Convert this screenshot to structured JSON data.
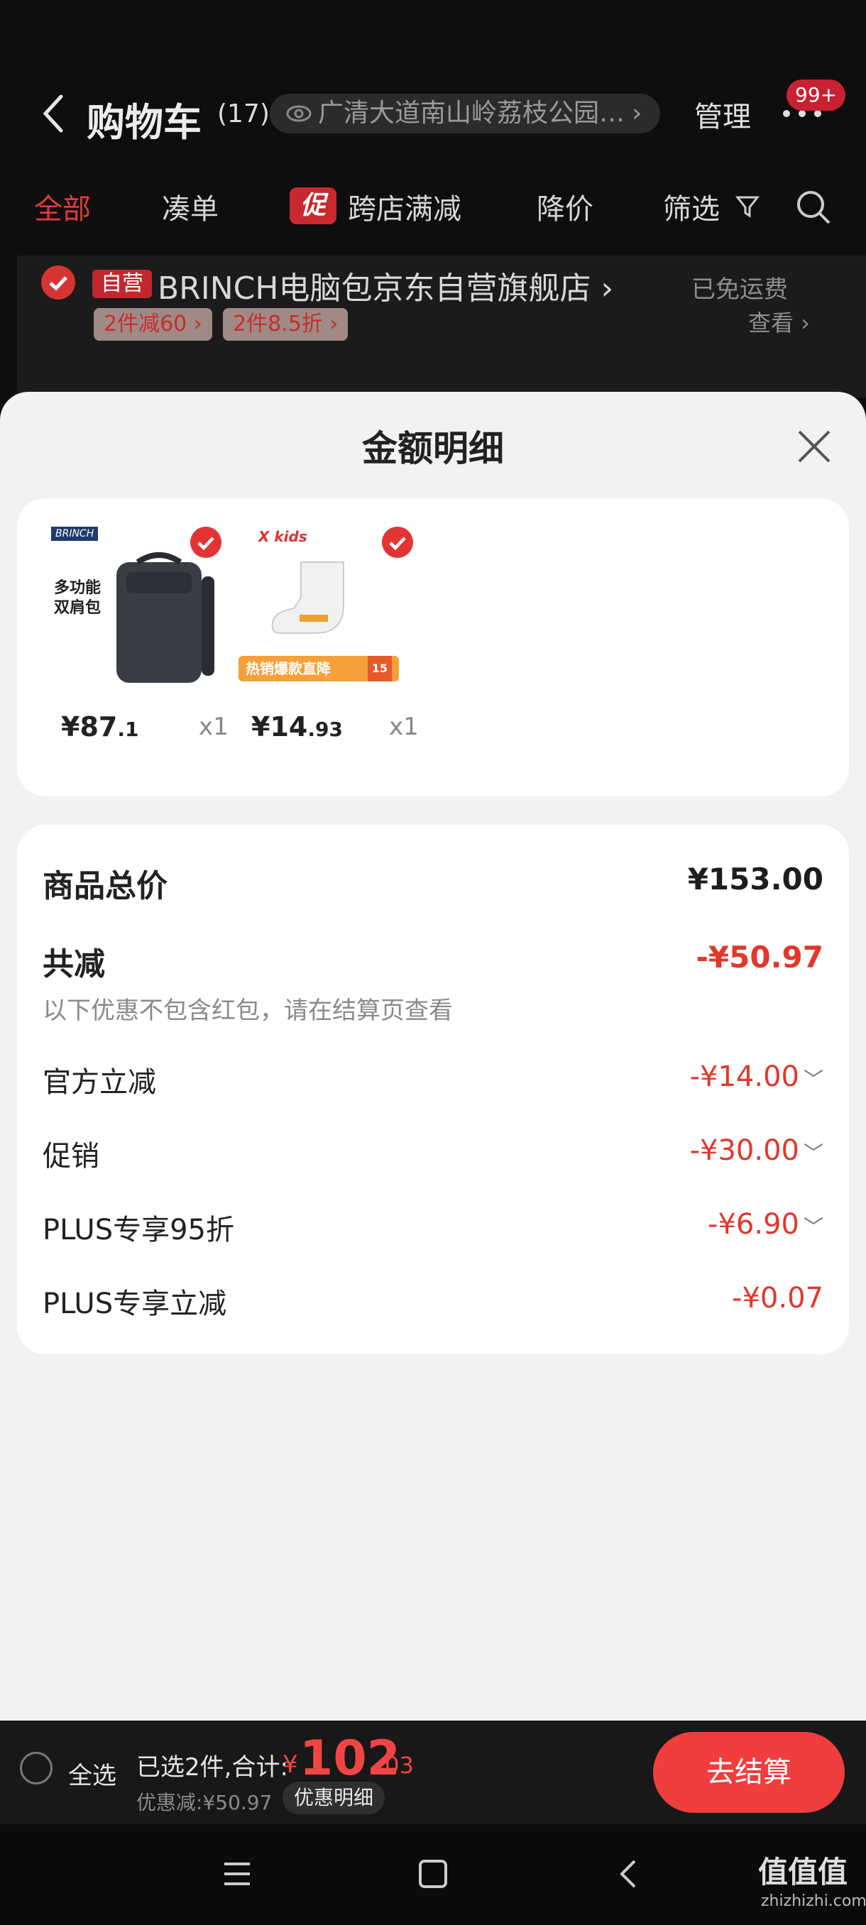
{
  "header": {
    "title": "购物车",
    "count": "(17)",
    "address": "广清大道南山岭荔枝公园…",
    "manage": "管理",
    "badge": "99+"
  },
  "tabs": [
    "全部",
    "凑单",
    "跨店满减",
    "降价",
    "筛选"
  ],
  "promo_icon_text": "促",
  "shop": {
    "self_badge": "自营",
    "name": "BRINCH电脑包京东自营旗舰店 ›",
    "freeship": "已免运费",
    "view": "查看 ›",
    "coupons": [
      "2件减60 ›",
      "2件8.5折 ›"
    ]
  },
  "sheet": {
    "title": "金额明细",
    "products": [
      {
        "price_int": "¥87",
        "price_dec": ".1",
        "qty": "x1",
        "brand": "BRINCH",
        "tag_line1": "多功能",
        "tag_line2": "双肩包"
      },
      {
        "price_int": "¥14",
        "price_dec": ".93",
        "qty": "x1",
        "brand": "X kids",
        "banner": "热销爆款直降",
        "banner_num": "15"
      }
    ],
    "summary": {
      "total_label": "商品总价",
      "total_value": "¥153.00",
      "reduce_label": "共减",
      "reduce_value": "-¥50.97",
      "note": "以下优惠不包含红包，请在结算页查看",
      "items": [
        {
          "label": "官方立减",
          "value": "-¥14.00",
          "chev": "﹀"
        },
        {
          "label": "促销",
          "value": "-¥30.00",
          "chev": "﹀"
        },
        {
          "label": "PLUS专享95折",
          "value": "-¥6.90",
          "chev": "﹀"
        },
        {
          "label": "PLUS专享立减",
          "value": "-¥0.07",
          "chev": ""
        }
      ]
    }
  },
  "bottom": {
    "select_all": "全选",
    "selected": "已选2件,合计:",
    "currency": "¥",
    "total_int": "102",
    "total_dec": ".03",
    "discount": "优惠减:¥50.97",
    "detail": "优惠明细",
    "checkout": "去结算"
  },
  "watermark": {
    "main": "值值值",
    "sub": "zhizhizhi.com"
  },
  "colors": {
    "accent": "#f03d3d",
    "bg": "#f2f2f2",
    "dark": "#0d0d0d"
  }
}
